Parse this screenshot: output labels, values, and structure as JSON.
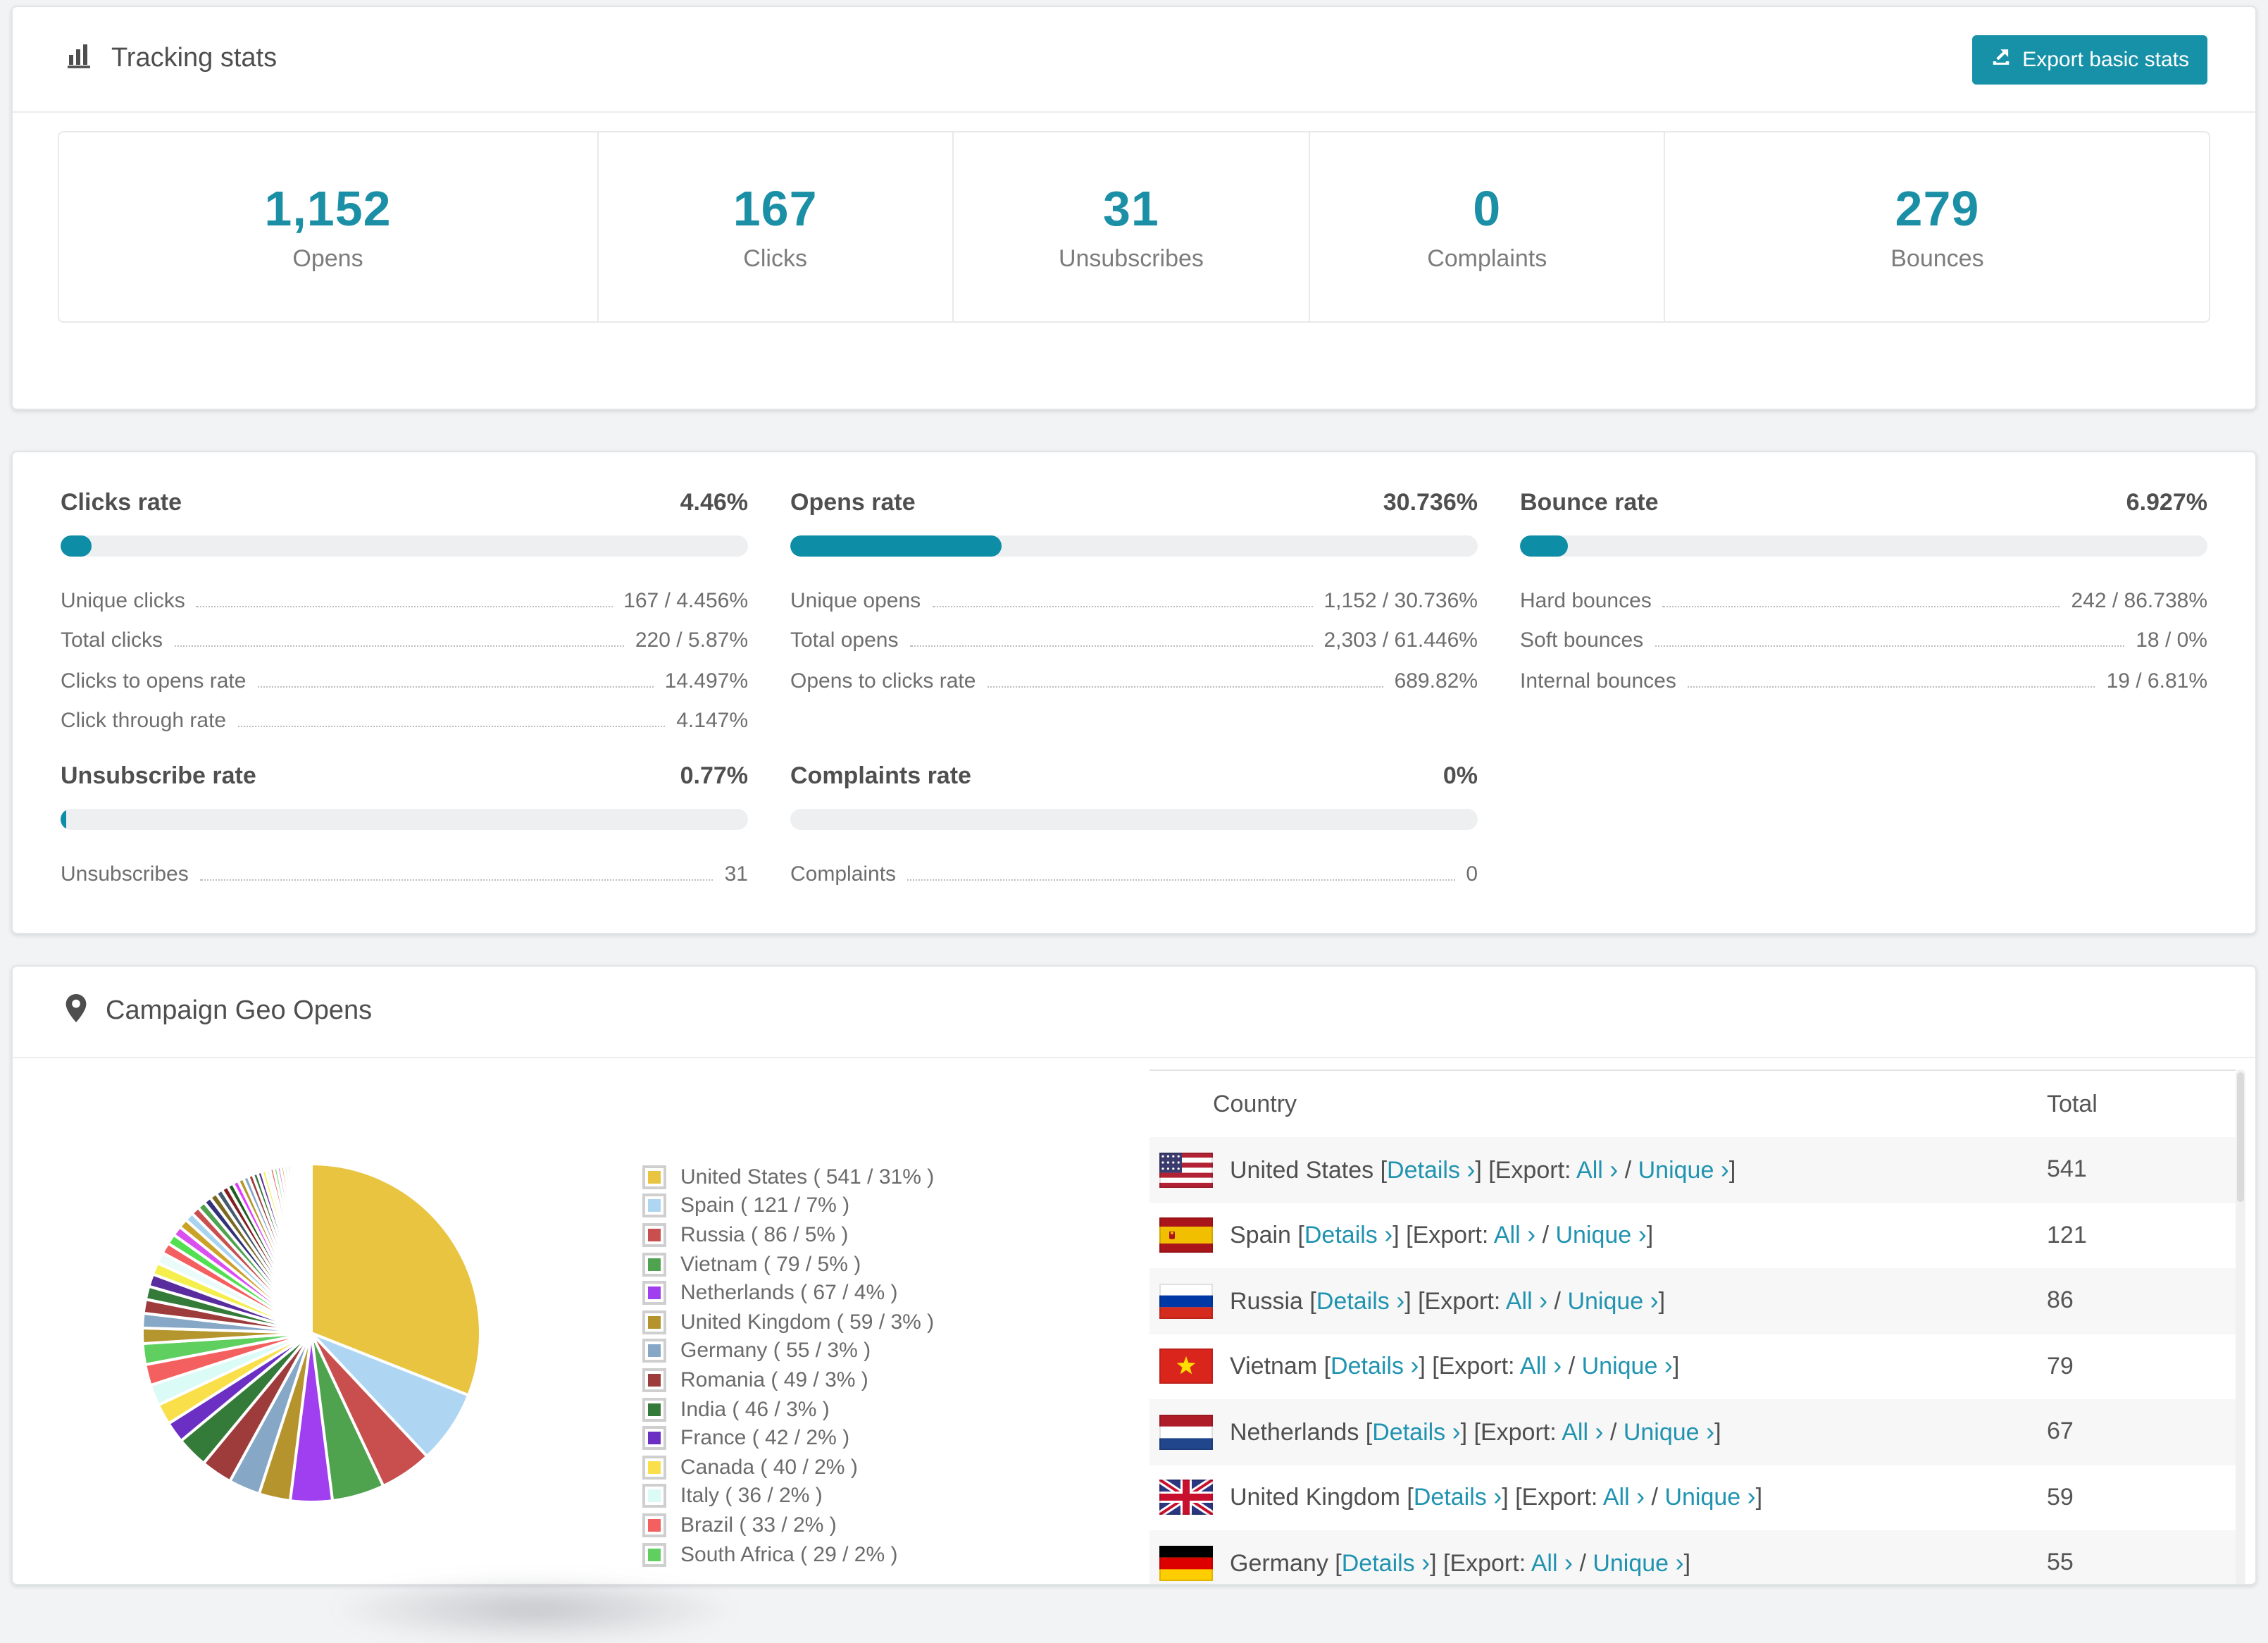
{
  "page": {
    "background": "#f2f3f4"
  },
  "colors": {
    "accent": "#1791a8",
    "link": "#2093b0",
    "stat_number": "#1b8fa6",
    "bar_track": "#edeff1",
    "bar_fill": "#0e8da6",
    "row_alt_background": "#f7f7f7"
  },
  "header": {
    "title": "Tracking stats",
    "icon": "bar-chart-icon",
    "export_button": {
      "label": "Export basic stats",
      "icon": "export-icon"
    }
  },
  "summary": [
    {
      "value": "1,152",
      "label": "Opens"
    },
    {
      "value": "167",
      "label": "Clicks"
    },
    {
      "value": "31",
      "label": "Unsubscribes"
    },
    {
      "value": "0",
      "label": "Complaints"
    },
    {
      "value": "279",
      "label": "Bounces"
    }
  ],
  "rates": [
    {
      "title": "Clicks rate",
      "value": "4.46%",
      "percent": 4.46,
      "rows": [
        {
          "label": "Unique clicks",
          "value": "167 / 4.456%"
        },
        {
          "label": "Total clicks",
          "value": "220 / 5.87%"
        },
        {
          "label": "Clicks to opens rate",
          "value": "14.497%"
        },
        {
          "label": "Click through rate",
          "value": "4.147%"
        }
      ]
    },
    {
      "title": "Opens rate",
      "value": "30.736%",
      "percent": 30.736,
      "rows": [
        {
          "label": "Unique opens",
          "value": "1,152 / 30.736%"
        },
        {
          "label": "Total opens",
          "value": "2,303 / 61.446%"
        },
        {
          "label": "Opens to clicks rate",
          "value": "689.82%"
        }
      ]
    },
    {
      "title": "Bounce rate",
      "value": "6.927%",
      "percent": 6.927,
      "rows": [
        {
          "label": "Hard bounces",
          "value": "242 / 86.738%"
        },
        {
          "label": "Soft bounces",
          "value": "18 / 0%"
        },
        {
          "label": "Internal bounces",
          "value": "19 / 6.81%"
        }
      ]
    },
    {
      "title": "Unsubscribe rate",
      "value": "0.77%",
      "percent": 0.77,
      "rows": [
        {
          "label": "Unsubscribes",
          "value": "31"
        }
      ]
    },
    {
      "title": "Complaints rate",
      "value": "0%",
      "percent": 0,
      "rows": [
        {
          "label": "Complaints",
          "value": "0"
        }
      ]
    }
  ],
  "geo": {
    "title": "Campaign Geo Opens",
    "icon": "map-pin-icon",
    "chart_data": {
      "type": "pie",
      "title": "Campaign Geo Opens",
      "legend_position": "right",
      "start_angle_deg": 0,
      "direction": "clockwise",
      "categories": [
        "United States",
        "Spain",
        "Russia",
        "Vietnam",
        "Netherlands",
        "United Kingdom",
        "Germany",
        "Romania",
        "India",
        "France",
        "Canada",
        "Italy",
        "Brazil",
        "South Africa"
      ],
      "counts": [
        541,
        121,
        86,
        79,
        67,
        59,
        55,
        49,
        46,
        42,
        40,
        36,
        33,
        29
      ],
      "percents": [
        31,
        7,
        5,
        5,
        4,
        3,
        3,
        3,
        3,
        2,
        2,
        2,
        2,
        2
      ],
      "colors": [
        "#e9c440",
        "#aed6f2",
        "#c94f4f",
        "#4fa34f",
        "#a03ff0",
        "#b5942d",
        "#86a7c5",
        "#9e3c3c",
        "#347a38",
        "#6c2fc4",
        "#f9e04b",
        "#dafbf6",
        "#f45f5f",
        "#5fd05f"
      ],
      "others": {
        "note": "many unlabeled thin slices filling the remainder of the pie",
        "total_percent": 26,
        "slice_count": 42,
        "decay": 0.95,
        "colors": [
          "#b5952d",
          "#86a7c5",
          "#9e3c3c",
          "#347a38",
          "#5a2d9e",
          "#f4ef4c",
          "#eafcfa",
          "#f45f5f",
          "#52e052",
          "#d94ff0",
          "#c9a227",
          "#a8d4f0",
          "#c94f4f",
          "#4fa34f",
          "#32327a",
          "#7a681f",
          "#445b70",
          "#801f1f",
          "#1f5c22",
          "#e040fb"
        ]
      }
    },
    "legend_format": "{country} ( {count} / {percent}% )",
    "table": {
      "columns": [
        "Country",
        "Total"
      ],
      "labels": {
        "details": "Details",
        "export": "Export:",
        "all": "All",
        "unique": "Unique",
        "chevron": "›"
      },
      "rows": [
        {
          "country": "United States",
          "flag": "us",
          "total": "541"
        },
        {
          "country": "Spain",
          "flag": "es",
          "total": "121"
        },
        {
          "country": "Russia",
          "flag": "ru",
          "total": "86"
        },
        {
          "country": "Vietnam",
          "flag": "vn",
          "total": "79"
        },
        {
          "country": "Netherlands",
          "flag": "nl",
          "total": "67"
        },
        {
          "country": "United Kingdom",
          "flag": "gb",
          "total": "59"
        },
        {
          "country": "Germany",
          "flag": "de",
          "total": "55",
          "partial": true
        }
      ]
    }
  }
}
